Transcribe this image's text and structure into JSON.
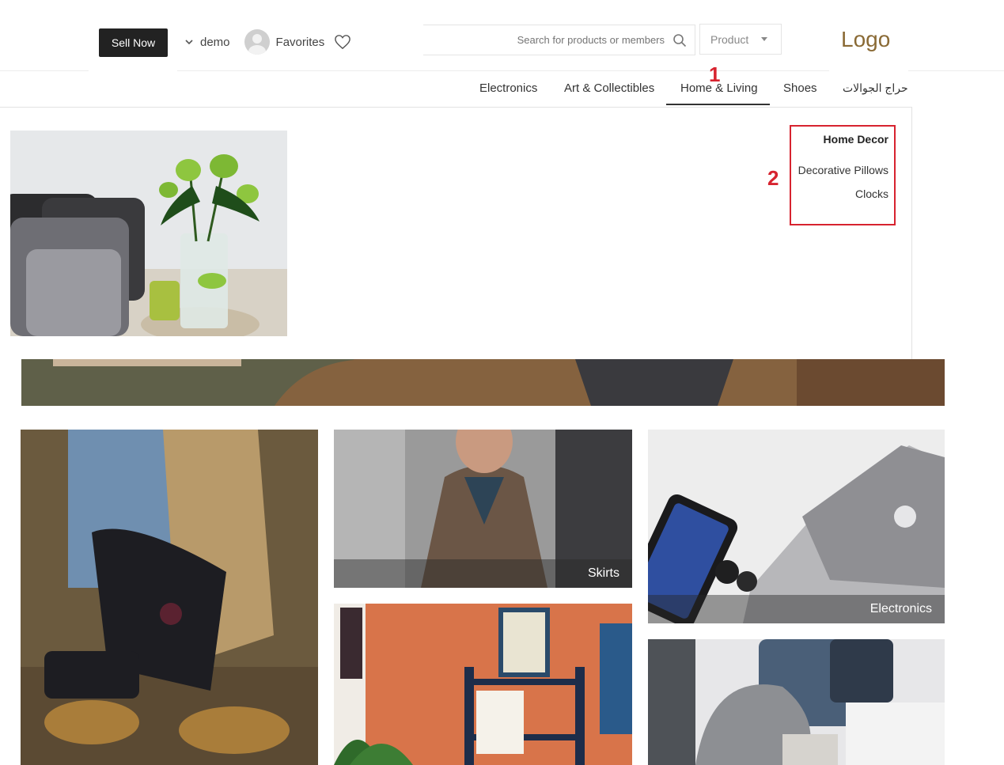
{
  "header": {
    "sell_now_label": "Sell Now",
    "user_name": "demo",
    "favorites_label": "Favorites",
    "search_placeholder": "Search for products or members",
    "search_type_selected": "Product",
    "logo_text": "Logo"
  },
  "nav": {
    "items": [
      {
        "label": "Electronics",
        "active": false
      },
      {
        "label": "Art & Collectibles",
        "active": false
      },
      {
        "label": "Home & Living",
        "active": true
      },
      {
        "label": "Shoes",
        "active": false
      },
      {
        "label": "حراج الجوالات",
        "active": false
      }
    ]
  },
  "mega_menu": {
    "heading": "Home Decor",
    "links": [
      "Decorative Pillows",
      "Clocks"
    ]
  },
  "annotations": {
    "marker_1": "1",
    "marker_2": "2"
  },
  "tiles": {
    "skirts_label": "Skirts",
    "electronics_label": "Electronics"
  },
  "icons": [
    "chevron-down-icon",
    "avatar",
    "heart-icon",
    "search-icon",
    "caret-down-icon"
  ],
  "colors": {
    "accent": "#8a6a35",
    "annotation": "#d7232f",
    "button": "#222222"
  }
}
